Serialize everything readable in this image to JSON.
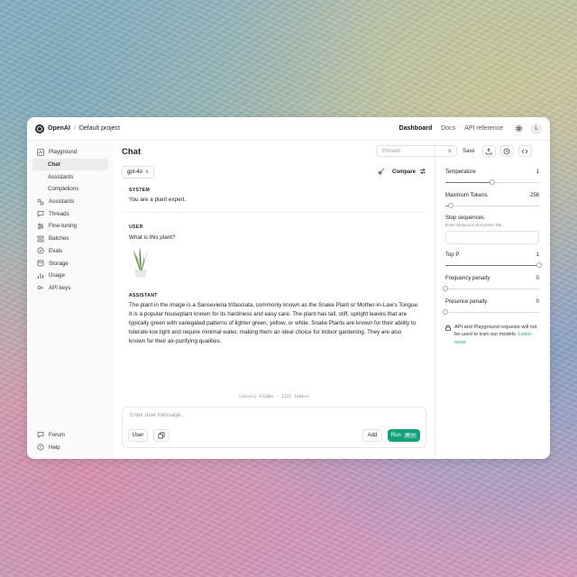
{
  "topbar": {
    "org": "OpenAI",
    "separator": "/",
    "project": "Default project",
    "links": [
      "Dashboard",
      "Docs",
      "API reference"
    ],
    "avatar_initial": "L"
  },
  "sidebar": {
    "items": [
      {
        "label": "Playground",
        "icon": "playground-icon"
      },
      {
        "label": "Chat",
        "sub": true,
        "selected": true
      },
      {
        "label": "Assistants",
        "sub": true
      },
      {
        "label": "Completions",
        "sub": true
      },
      {
        "label": "Assistants",
        "icon": "assistants-icon"
      },
      {
        "label": "Threads",
        "icon": "threads-icon"
      },
      {
        "label": "Fine-tuning",
        "icon": "fine-tuning-icon"
      },
      {
        "label": "Batches",
        "icon": "batches-icon"
      },
      {
        "label": "Evals",
        "icon": "evals-icon"
      },
      {
        "label": "Storage",
        "icon": "storage-icon"
      },
      {
        "label": "Usage",
        "icon": "usage-icon"
      },
      {
        "label": "API keys",
        "icon": "api-keys-icon"
      }
    ],
    "bottom": [
      {
        "label": "Forum",
        "icon": "forum-icon"
      },
      {
        "label": "Help",
        "icon": "help-icon"
      }
    ]
  },
  "main": {
    "title": "Chat",
    "model": "gpt-4o",
    "compare_label": "Compare",
    "messages": {
      "system_role": "SYSTEM",
      "system_text": "You are a plant expert.",
      "user_role": "USER",
      "user_text": "What is this plant?",
      "assistant_role": "ASSISTANT",
      "assistant_text": "The plant in the image is a Sansevieria trifasciata, commonly known as the Snake Plant or Mother-in-Law's Tongue. It is a popular houseplant known for its hardiness and easy care. The plant has tall, stiff, upright leaves that are typically green with variegated patterns of lighter green, yellow, or white. Snake Plants are known for their ability to tolerate low light and require minimal water, making them an ideal choice for indoor gardening. They are also known for their air-purifying qualities."
    },
    "latency": "Latency 6320ms · 1237 tokens",
    "composer": {
      "placeholder": "Enter user message...",
      "role_button": "User",
      "add_button": "Add",
      "run_button": "Run",
      "run_shortcut": "⌘ ↵"
    }
  },
  "header_controls": {
    "presets_placeholder": "Presets",
    "save_label": "Save"
  },
  "params": {
    "temperature_label": "Temperature",
    "temperature_value": "1",
    "temperature_fraction": 0.5,
    "max_tokens_label": "Maximum Tokens",
    "max_tokens_value": "256",
    "max_tokens_fraction": 0.06,
    "stop_label": "Stop sequences",
    "stop_help": "Enter sequence and press Tab",
    "top_p_label": "Top P",
    "top_p_value": "1",
    "top_p_fraction": 1.0,
    "freq_label": "Frequency penalty",
    "freq_value": "0",
    "freq_fraction": 0.0,
    "presence_label": "Presence penalty",
    "presence_value": "0",
    "presence_fraction": 0.0,
    "notice_text": "API and Playground requests will not be used to train our models.",
    "notice_link": "Learn more"
  },
  "colors": {
    "accent": "#13a37c"
  }
}
